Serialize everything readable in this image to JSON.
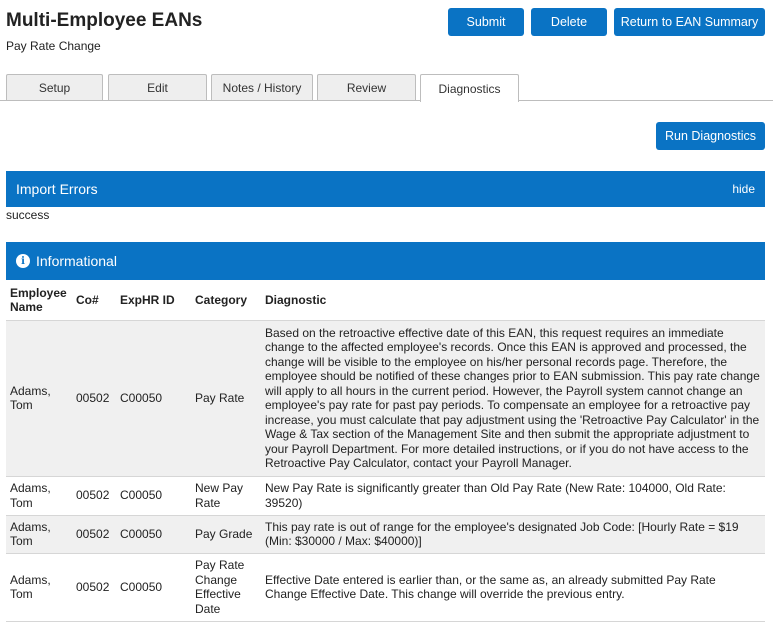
{
  "header": {
    "title": "Multi-Employee EANs",
    "subtitle": "Pay Rate Change"
  },
  "actions": {
    "submit": "Submit",
    "delete": "Delete",
    "return": "Return to EAN Summary",
    "run_diagnostics": "Run Diagnostics"
  },
  "tabs": [
    {
      "label": "Setup"
    },
    {
      "label": "Edit"
    },
    {
      "label": "Notes / History"
    },
    {
      "label": "Review"
    },
    {
      "label": "Diagnostics",
      "active": true
    }
  ],
  "import_errors": {
    "title": "Import Errors",
    "hide_label": "hide",
    "message": "success"
  },
  "informational": {
    "icon": "info-icon",
    "icon_glyph": "i",
    "title": "Informational",
    "columns": {
      "employee": "Employee Name",
      "co": "Co#",
      "exphr": "ExpHR ID",
      "category": "Category",
      "diagnostic": "Diagnostic"
    },
    "rows": [
      {
        "employee": "Adams, Tom",
        "co": "00502",
        "exphr": "C00050",
        "category": "Pay Rate",
        "diagnostic": "Based on the retroactive effective date of this EAN, this request requires an immediate change to the affected employee's records. Once this EAN is approved and processed, the change will be visible to the employee on his/her personal records page. Therefore, the employee should be notified of these changes prior to EAN submission. This pay rate change will apply to all hours in the current period. However, the Payroll system cannot change an employee's pay rate for past pay periods. To compensate an employee for a retroactive pay increase, you must calculate that pay adjustment using the 'Retroactive Pay Calculator' in the Wage & Tax section of the Management Site and then submit the appropriate adjustment to your Payroll Department. For more detailed instructions, or if you do not have access to the Retroactive Pay Calculator, contact your Payroll Manager."
      },
      {
        "employee": "Adams, Tom",
        "co": "00502",
        "exphr": "C00050",
        "category": "New Pay Rate",
        "diagnostic": "New Pay Rate is significantly greater than Old Pay Rate (New Rate: 104000, Old Rate: 39520)"
      },
      {
        "employee": "Adams, Tom",
        "co": "00502",
        "exphr": "C00050",
        "category": "Pay Grade",
        "diagnostic": "This pay rate is out of range for the employee's designated Job Code: [Hourly Rate = $19 (Min: $30000 / Max: $40000)]"
      },
      {
        "employee": "Adams, Tom",
        "co": "00502",
        "exphr": "C00050",
        "category": "Pay Rate Change Effective Date",
        "diagnostic": "Effective Date entered is earlier than, or the same as, an already submitted Pay Rate Change Effective Date. This change will override the previous entry."
      }
    ]
  }
}
